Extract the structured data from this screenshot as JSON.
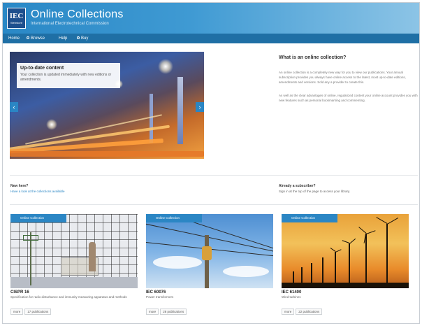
{
  "header": {
    "logo_top": "IEC",
    "logo_bottom": "Webstore",
    "title": "Online Collections",
    "subtitle": "International Electrotechnical Commission"
  },
  "nav": [
    {
      "label": "Home",
      "icon": "home-icon"
    },
    {
      "label": "Browse",
      "icon": "search-icon"
    },
    {
      "label": "Help",
      "icon": "help-icon"
    },
    {
      "label": "Buy",
      "icon": "cart-icon"
    }
  ],
  "hero": {
    "caption_title": "Up-to-date content",
    "caption_text": "Your collection is updated immediately with new editions or amendments.",
    "prev": "‹",
    "next": "›"
  },
  "intro": {
    "heading": "What is an online collection?",
    "p1": "An online collection is a completely new way for you to view our publications. Your annual subscription provides you always have online access to the latest, most up-to-date editions, amendments and versions. Sold any a provider to create this.",
    "p2": "As well as the clear advantages of online, regularized content your online account provides you with new features such as personal bookmarking and commenting."
  },
  "left_info": {
    "heading": "New here?",
    "link": "Have a look at the collections available"
  },
  "right_info": {
    "heading": "Already a subscriber?",
    "text": "Sign in at the top of the page to access your library."
  },
  "cards": [
    {
      "badge": "Online Collection",
      "title": "CISPR 16",
      "desc": "Specification for radio disturbance and immunity measuring apparatus and methods",
      "btn1": "more",
      "btn2": "17 publications"
    },
    {
      "badge": "Online Collection",
      "title": "IEC 60076",
      "desc": "Power transformers",
      "btn1": "more",
      "btn2": "28 publications"
    },
    {
      "badge": "Online Collection",
      "title": "IEC 61400",
      "desc": "Wind turbines",
      "btn1": "more",
      "btn2": "22 publications"
    }
  ],
  "colors": {
    "brand_blue": "#2b86c4",
    "nav_blue": "#1f6fa5"
  }
}
